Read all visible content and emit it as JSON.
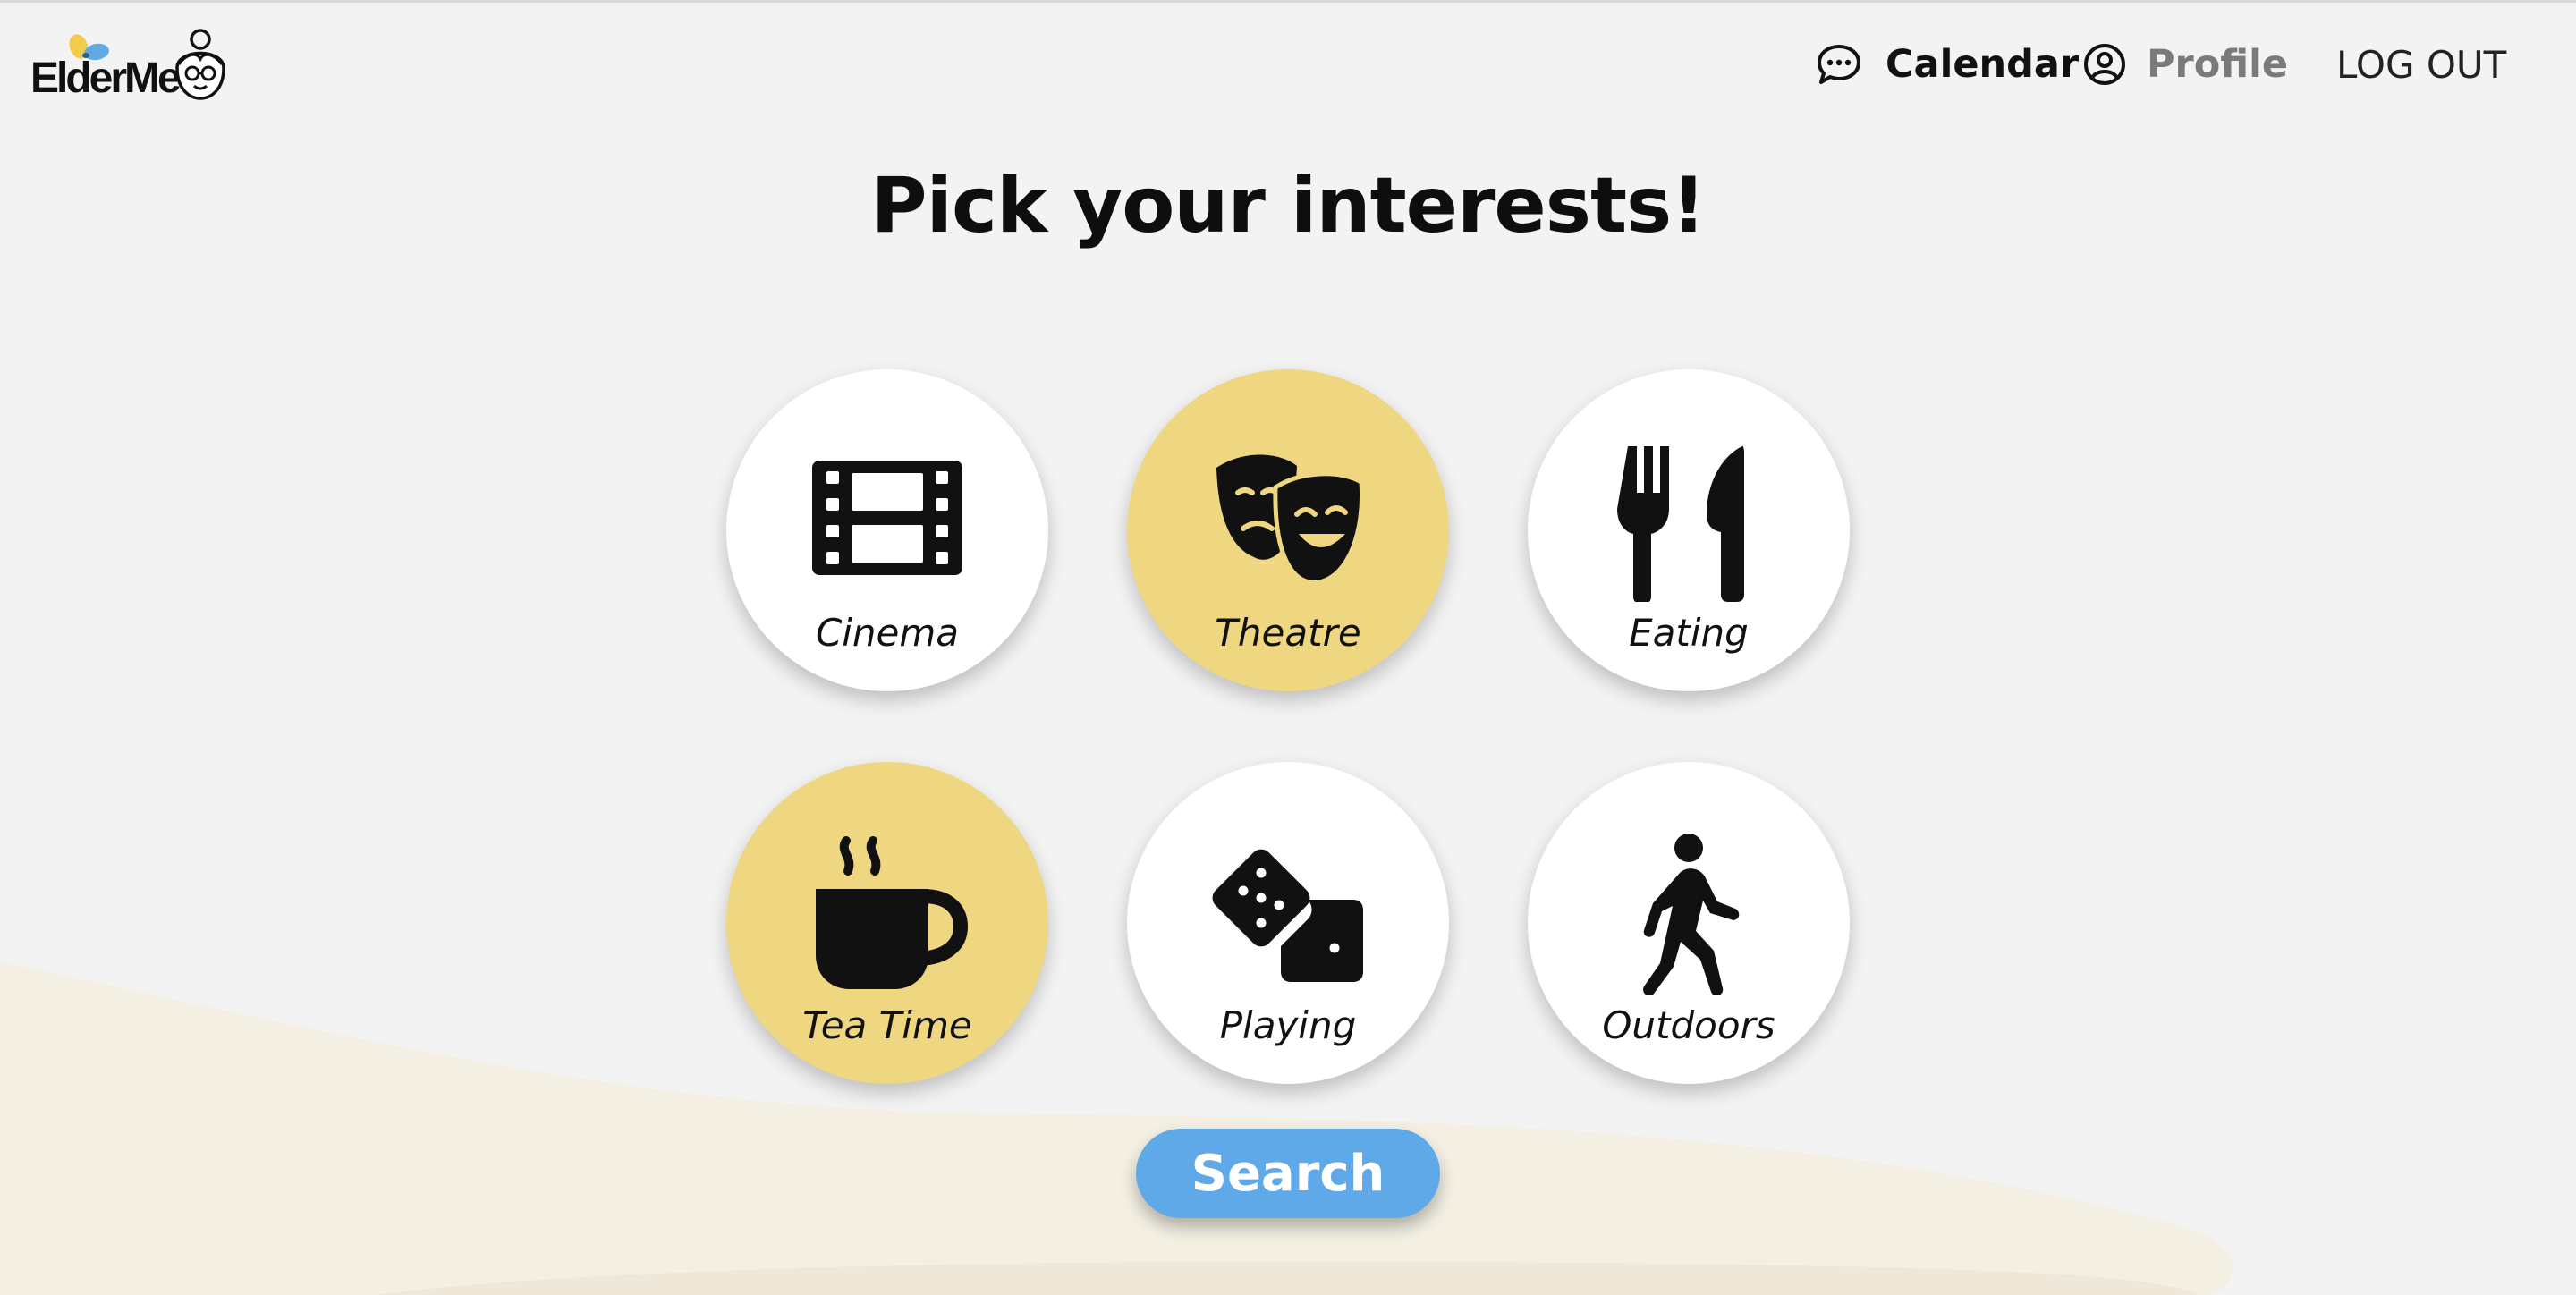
{
  "app": {
    "logo_text": "ElderMe"
  },
  "nav": {
    "calendar_label": "Calendar",
    "profile_label": "Profile",
    "logout_label": "LOG OUT"
  },
  "page": {
    "title": "Pick your interests!"
  },
  "interests": [
    {
      "label": "Cinema",
      "icon": "film-icon",
      "selected": false
    },
    {
      "label": "Theatre",
      "icon": "theatre-masks-icon",
      "selected": true
    },
    {
      "label": "Eating",
      "icon": "fork-knife-icon",
      "selected": false
    },
    {
      "label": "Tea Time",
      "icon": "coffee-cup-icon",
      "selected": true
    },
    {
      "label": "Playing",
      "icon": "dice-icon",
      "selected": false
    },
    {
      "label": "Outdoors",
      "icon": "walking-person-icon",
      "selected": false
    }
  ],
  "search": {
    "label": "Search"
  },
  "colors": {
    "background": "#f3f3f3",
    "selected_tile": "#efd781",
    "unselected_tile": "#ffffff",
    "search_button": "#5fa9e8",
    "wave": "#f3efe2"
  }
}
